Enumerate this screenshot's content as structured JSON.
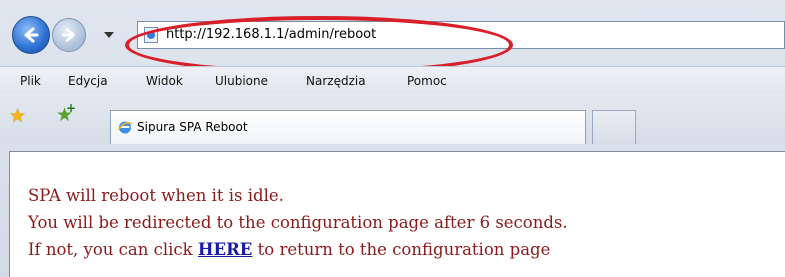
{
  "browser": {
    "address_url": "http://192.168.1.1/admin/reboot",
    "menu": [
      "Plik",
      "Edycja",
      "Widok",
      "Ulubione",
      "Narzędzia",
      "Pomoc"
    ],
    "tab_title": "Sipura SPA Reboot"
  },
  "icons": {
    "back": "back-arrow-icon",
    "forward": "forward-arrow-icon",
    "favorites": "star-icon",
    "add_favorites": "add-favorites-icon",
    "page": "ie-page-icon"
  },
  "colors": {
    "content_text": "#8b1a1a",
    "link": "#1a1aa8",
    "highlight": "#d9202a"
  },
  "page": {
    "line1": "SPA will reboot when it is idle.",
    "line2": "You will be redirected to the configuration page after 6 seconds.",
    "line3_before": "If not, you can click",
    "link_text": "HERE",
    "line3_after": "to return to the configuration page"
  }
}
